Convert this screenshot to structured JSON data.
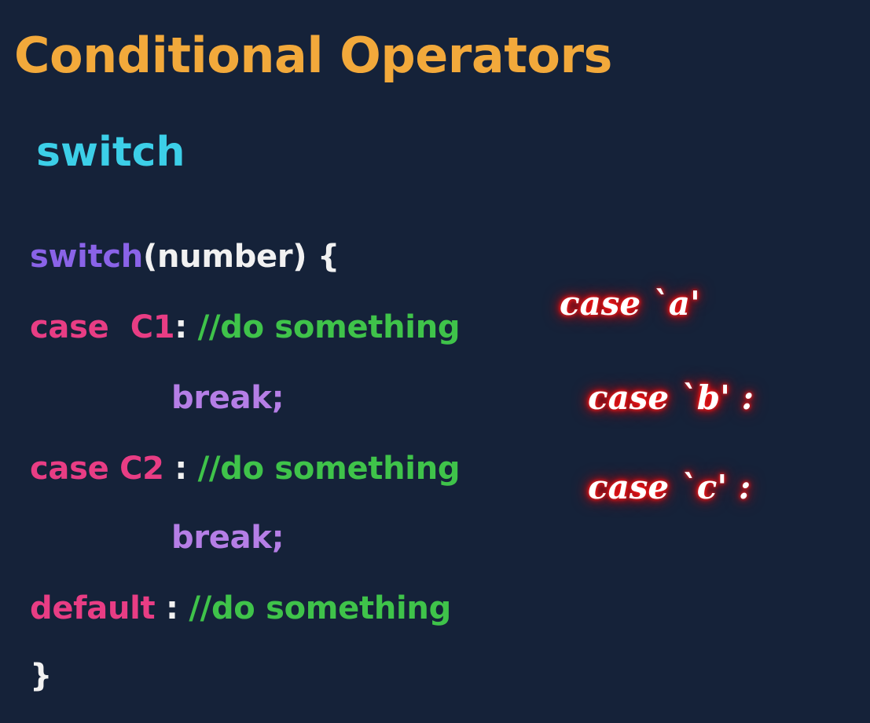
{
  "slide": {
    "title": "Conditional Operators",
    "subtitle": "switch"
  },
  "code": {
    "line1": {
      "keyword": "switch",
      "rest": "(number) {"
    },
    "line2": {
      "keyword": "case  C1",
      "sep": ":",
      "comment": "//do something"
    },
    "line3": {
      "keyword": "break;"
    },
    "line4": {
      "keyword": "case C2",
      "sep": " :",
      "comment": "//do something"
    },
    "line5": {
      "keyword": "break;"
    },
    "line6": {
      "keyword": "default",
      "sep": " :",
      "comment": "//do something"
    },
    "line7": {
      "rest": "}"
    }
  },
  "annotations": {
    "a": "case `a'",
    "b": "case `b' :",
    "c": "case `c' :"
  },
  "colors": {
    "background": "#152239",
    "title": "#f2a93b",
    "subtitle": "#3ccfe8",
    "switch_keyword": "#8a63e8",
    "case_keyword": "#e83d84",
    "comment": "#3fc34a",
    "break_keyword": "#b57ee6",
    "annotation_glow": "#ff1a1a"
  }
}
